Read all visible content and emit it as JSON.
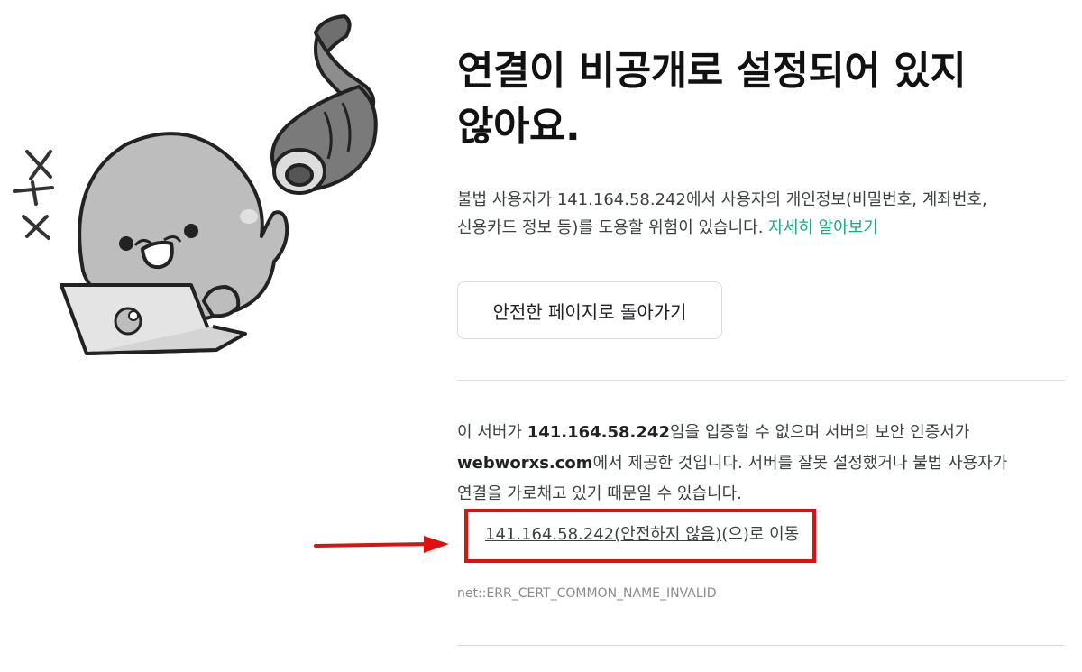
{
  "interstitial": {
    "title_line1": "연결이 비공개로 설정되어 있지",
    "title_line2": "않아요.",
    "description_part1": "불법 사용자가 ",
    "description_host": "141.164.58.242",
    "description_part2": "에서 사용자의 개인정보(비밀번호, 계좌번호,",
    "description_part3": "신용카드 정보 등)를 도용할 위험이 있습니다.",
    "learn_more_label": "자세히 알아보기",
    "back_button_label": "안전한 페이지로 돌아가기"
  },
  "details": {
    "line1_prefix": "이 서버가 ",
    "line1_host": "141.164.58.242",
    "line1_suffix": "임을 입증할 수 없으며 서버의 보안 인증서가",
    "line2_domain": "webworxs.com",
    "line2_suffix": "에서 제공한 것입니다. 서버를 잘못 설정했거나 불법 사용자가",
    "line3": "연결을 가로채고 있기 때문일 수 있습니다.",
    "proceed_link_underlined": "141.164.58.242(안전하지 않음)",
    "proceed_link_suffix": "(으)로 이동",
    "error_code": "net::ERR_CERT_COMMON_NAME_INVALID"
  },
  "annotation": {
    "highlight_color": "#e01010",
    "arrow_color": "#e01010"
  },
  "colors": {
    "link": "#1ba784",
    "divider": "#dadce0",
    "error_code": "#8a8a8a"
  },
  "icons": {
    "illustration": "mascot-on-laptop-with-security-camera-illustration",
    "arrow": "red-arrow-right-icon"
  }
}
